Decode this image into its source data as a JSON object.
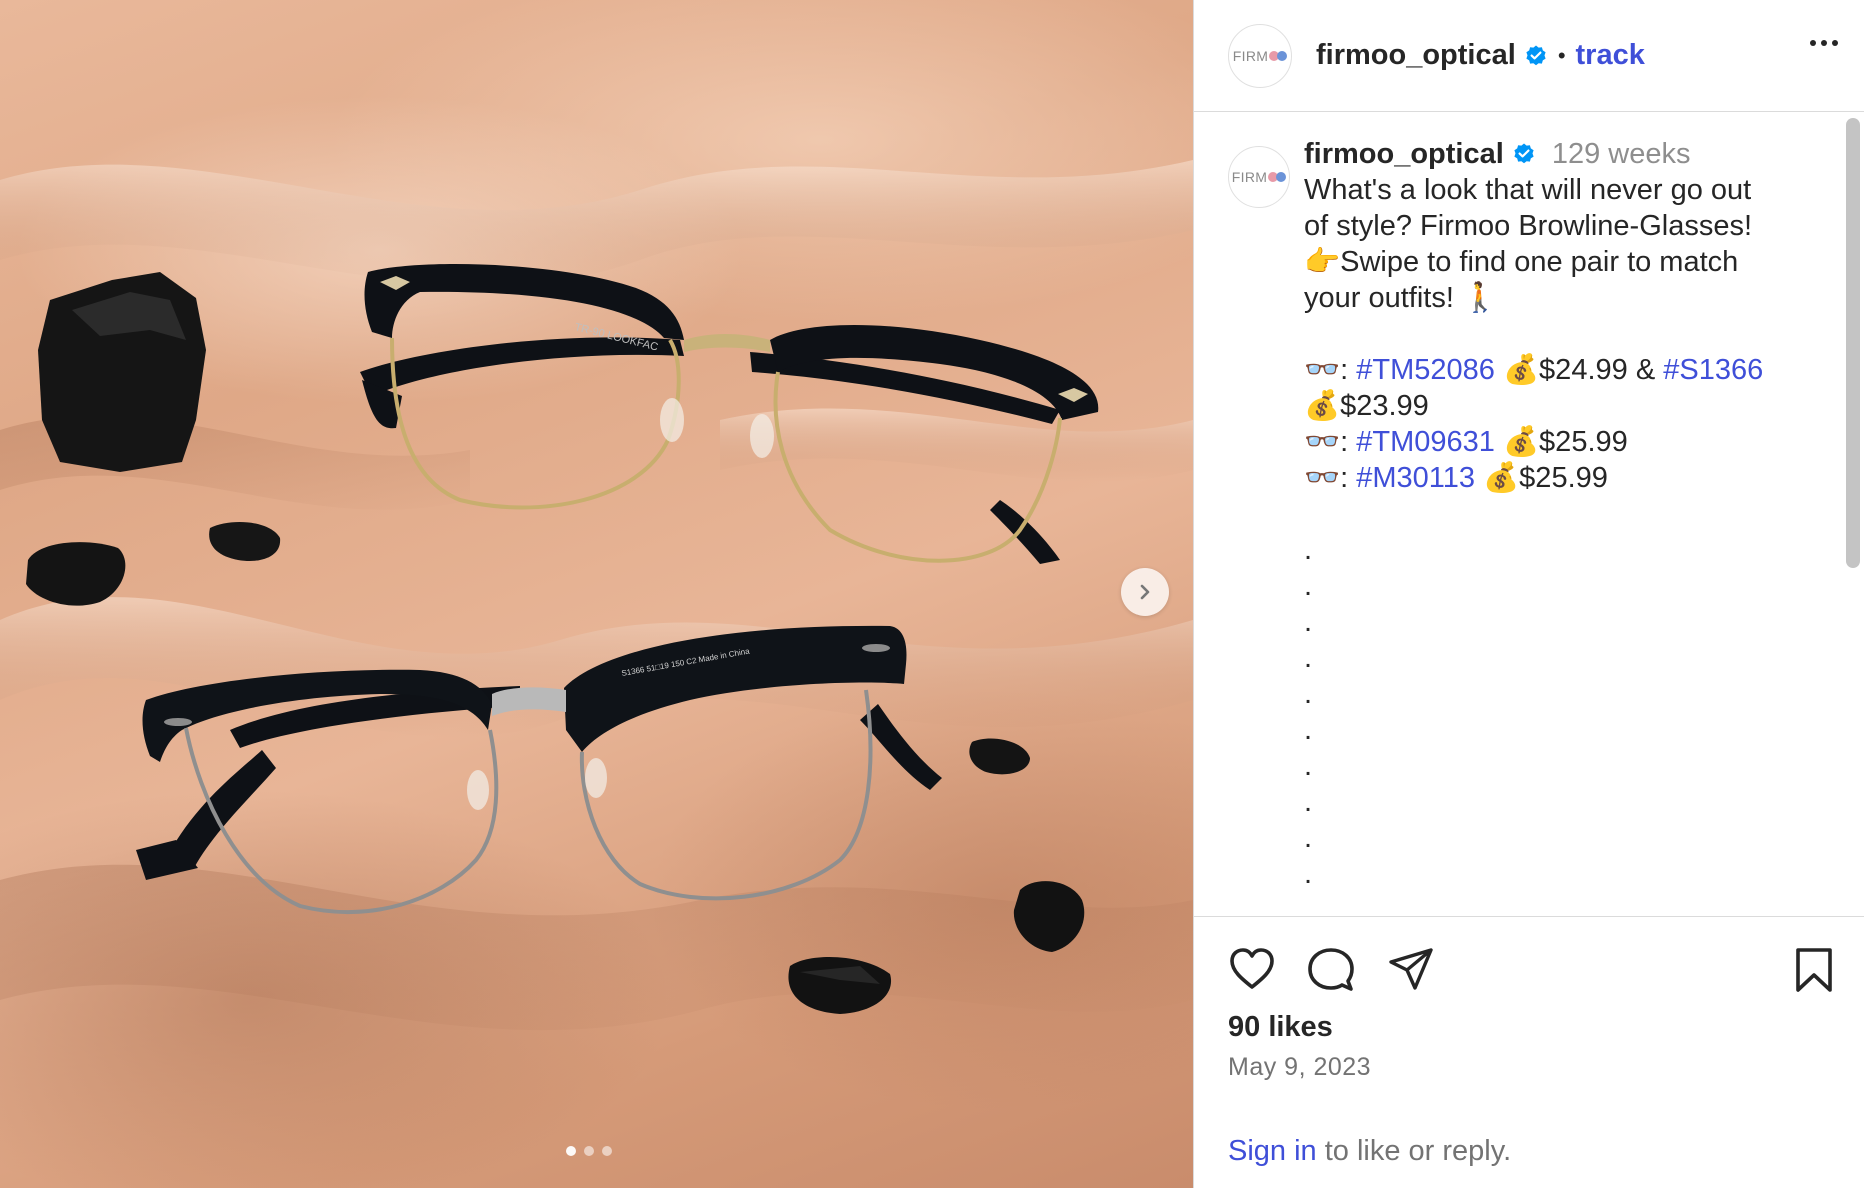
{
  "header": {
    "username": "firmoo_optical",
    "follow_label": "track",
    "avatar_text": "FIRM"
  },
  "caption": {
    "username": "firmoo_optical",
    "time": "129 weeks",
    "lines": [
      "What's a look that will never go out",
      "of style? Firmoo Browline-Glasses!",
      "👉Swipe to find one pair to match",
      "your outfits! 🚶"
    ],
    "products": [
      {
        "prefix": "👓: ",
        "tag": "#TM52086",
        "price": " 💰$24.99 & ",
        "tag2": "#S1366"
      },
      {
        "prefix": "",
        "tag": "",
        "price": "💰$23.99",
        "tag2": ""
      },
      {
        "prefix": "👓: ",
        "tag": "#TM09631",
        "price": " 💰$25.99",
        "tag2": ""
      },
      {
        "prefix": "👓: ",
        "tag": "#M30113",
        "price": " 💰$25.99",
        "tag2": ""
      }
    ],
    "dots": [
      ".",
      ".",
      ".",
      ".",
      ".",
      ".",
      ".",
      ".",
      ".",
      "."
    ]
  },
  "footer": {
    "likes": "90 likes",
    "date": "May 9, 2023",
    "signin_link": "Sign in",
    "signin_rest": " to like or reply."
  },
  "media": {
    "glasses_top_text": "TR-90 LOOKFAC",
    "glasses_bottom_text": "S1366 51□19 150 C2 Made in China",
    "carousel_count": 3,
    "carousel_active": 0
  },
  "colors": {
    "link": "#3f4fd8",
    "verified": "#0095f6",
    "text": "#262626",
    "muted": "#8e8e8e"
  }
}
